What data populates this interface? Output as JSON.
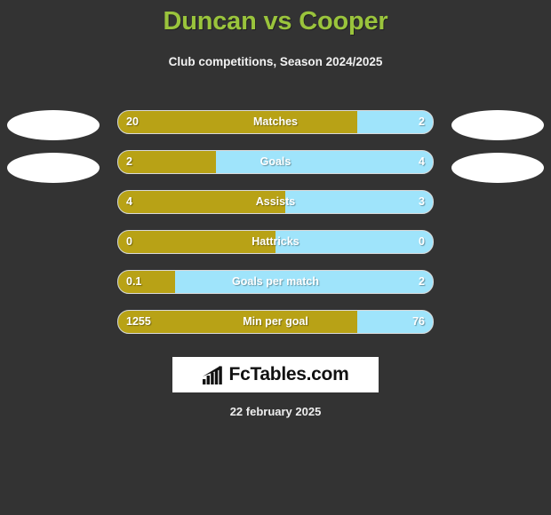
{
  "header": {
    "title": "Duncan vs Cooper",
    "subtitle": "Club competitions, Season 2024/2025",
    "title_color": "#9ac43c",
    "subtitle_color": "#f2f2f2"
  },
  "theme": {
    "background": "#333333",
    "home_color": "#b8a216",
    "away_color": "#9fe4fb",
    "bar_border": "#d9d9d9"
  },
  "team_logos": {
    "home": [
      "home-logo-placeholder-1",
      "home-logo-placeholder-2"
    ],
    "away": [
      "away-logo-placeholder-1",
      "away-logo-placeholder-2"
    ]
  },
  "chart_data": {
    "type": "bar",
    "title": "Duncan vs Cooper",
    "subtitle": "Club competitions, Season 2024/2025",
    "xlabel": "",
    "ylabel": "",
    "orientation": "horizontal-diverging",
    "categories": [
      "Matches",
      "Goals",
      "Assists",
      "Hattricks",
      "Goals per match",
      "Min per goal"
    ],
    "series": [
      {
        "name": "Duncan",
        "values": [
          20,
          2,
          4,
          0,
          0.1,
          1255
        ]
      },
      {
        "name": "Cooper",
        "values": [
          2,
          4,
          3,
          0,
          2,
          76
        ]
      }
    ],
    "legend": "none",
    "grid": false
  },
  "stats": [
    {
      "label": "Matches",
      "home": "20",
      "away": "2",
      "home_pct": 76
    },
    {
      "label": "Goals",
      "home": "2",
      "away": "4",
      "home_pct": 31
    },
    {
      "label": "Assists",
      "home": "4",
      "away": "3",
      "home_pct": 53
    },
    {
      "label": "Hattricks",
      "home": "0",
      "away": "0",
      "home_pct": 50
    },
    {
      "label": "Goals per match",
      "home": "0.1",
      "away": "2",
      "home_pct": 18
    },
    {
      "label": "Min per goal",
      "home": "1255",
      "away": "76",
      "home_pct": 76
    }
  ],
  "footer": {
    "brand_text": "FcTables.com",
    "brand_icon": "bar-chart-growth-icon",
    "date": "22 february 2025"
  }
}
